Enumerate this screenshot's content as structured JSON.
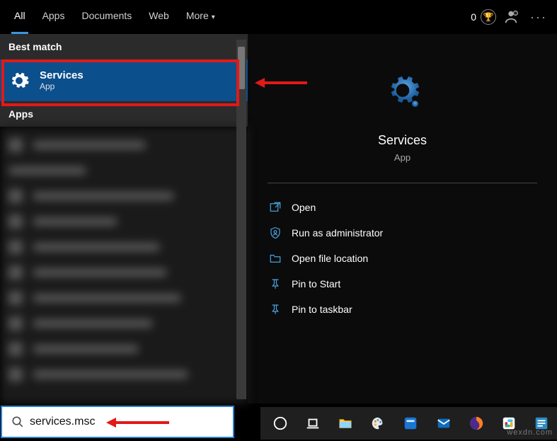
{
  "tabs": {
    "all": "All",
    "apps": "Apps",
    "documents": "Documents",
    "web": "Web",
    "more": "More"
  },
  "top_right": {
    "points": "0"
  },
  "sections": {
    "best": "Best match",
    "apps": "Apps"
  },
  "best": {
    "title": "Services",
    "subtitle": "App"
  },
  "preview": {
    "title": "Services",
    "subtitle": "App"
  },
  "actions": {
    "open": "Open",
    "admin": "Run as administrator",
    "loc": "Open file location",
    "pinstart": "Pin to Start",
    "pintask": "Pin to taskbar"
  },
  "search": {
    "value": "services.msc"
  },
  "watermark": "wexdn.com"
}
